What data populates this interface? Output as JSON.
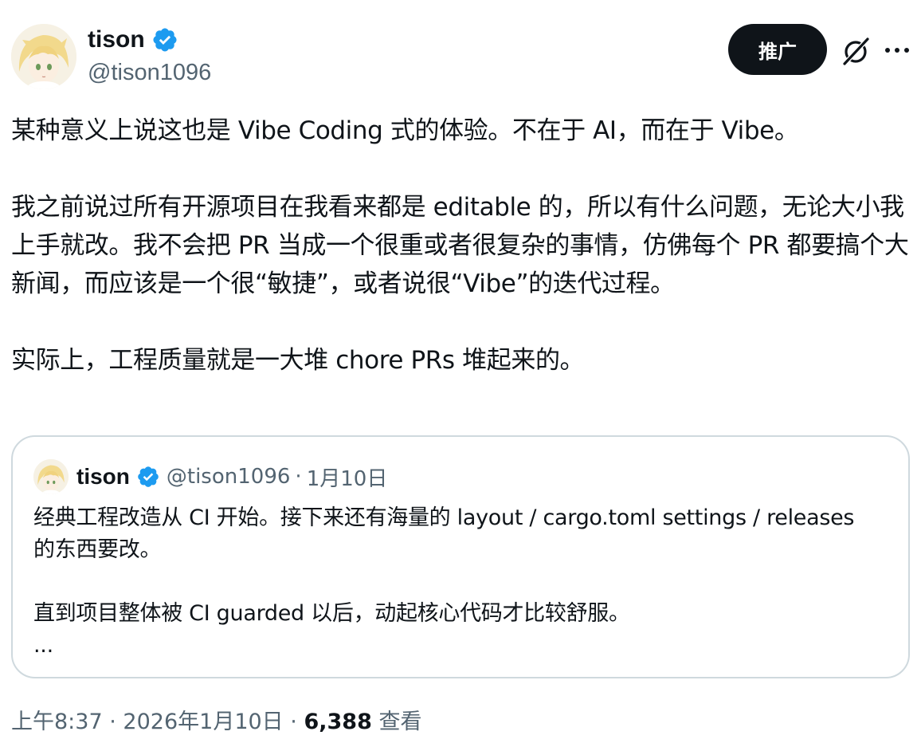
{
  "author": {
    "name": "tison",
    "handle": "@tison1096"
  },
  "actions": {
    "promote_label": "推广"
  },
  "icons": {
    "verified": "verified-badge-icon",
    "grok": "grok-icon",
    "more": "more-options-icon"
  },
  "colors": {
    "verified_blue": "#1d9bf0",
    "text_primary": "#0f1419",
    "text_secondary": "#536471",
    "border": "#cfd9de"
  },
  "tweet": {
    "text": "某种意义上说这也是 Vibe Coding 式的体验。不在于 AI，而在于 Vibe。\n\n我之前说过所有开源项目在我看来都是 editable 的，所以有什么问题，无论大小我上手就改。我不会把 PR 当成一个很重或者很复杂的事情，仿佛每个 PR 都要搞个大新闻，而应该是一个很“敏捷”，或者说很“Vibe”的迭代过程。\n\n实际上，工程质量就是一大堆 chore PRs 堆起来的。"
  },
  "quote": {
    "name": "tison",
    "handle": "@tison1096",
    "separator": "·",
    "date": "1月10日",
    "text": "经典工程改造从 CI 开始。接下来还有海量的 layout / cargo.toml settings / releases 的东西要改。\n\n直到项目整体被 CI guarded 以后，动起核心代码才比较舒服。\n..."
  },
  "footer": {
    "time": "上午8:37",
    "separator": "·",
    "date": "2026年1月10日",
    "views_count": "6,388",
    "views_label": "查看"
  }
}
